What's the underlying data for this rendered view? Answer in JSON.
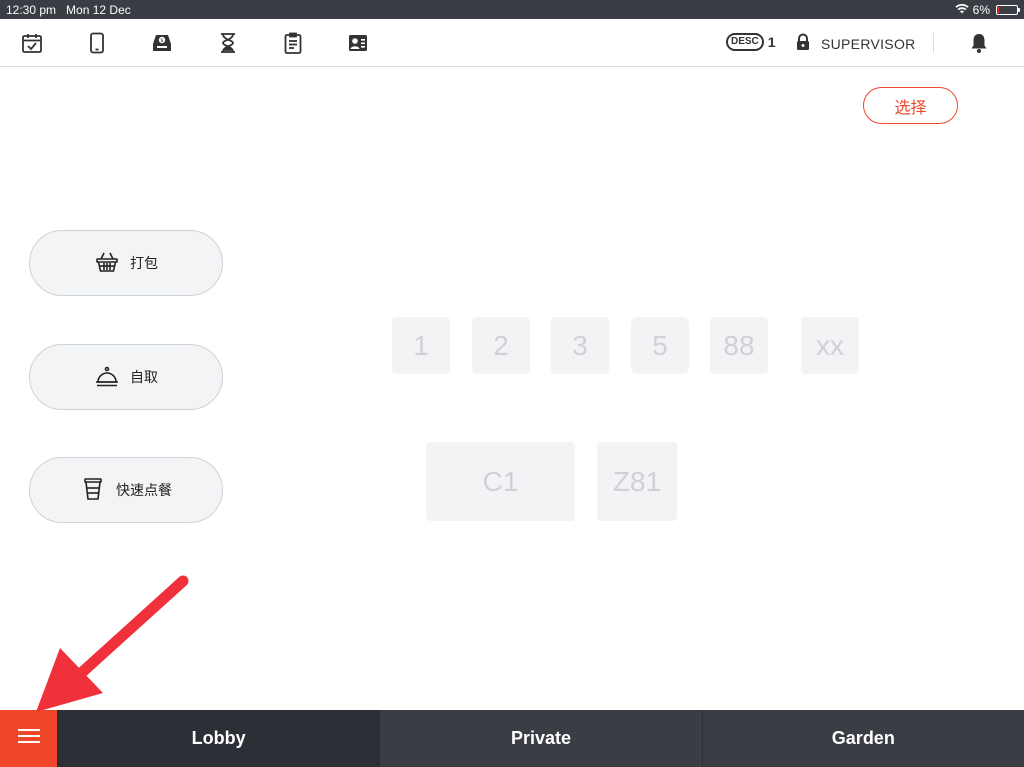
{
  "status_bar": {
    "time": "12:30 pm",
    "date": "Mon 12 Dec",
    "battery": "6%",
    "battery_level": 0.06
  },
  "toolbar": {
    "icons": [
      "calendar-check-icon",
      "tablet-icon",
      "cash-drawer-icon",
      "hourglass-icon",
      "clipboard-icon",
      "staff-card-icon"
    ],
    "desc_label": "DESC",
    "desc_count": "1",
    "role": "SUPERVISOR"
  },
  "select_button": "选择",
  "order_types": [
    {
      "label": "打包",
      "icon": "basket-icon"
    },
    {
      "label": "自取",
      "icon": "cloche-icon"
    },
    {
      "label": "快速点餐",
      "icon": "cup-icon"
    }
  ],
  "tables": [
    "1",
    "2",
    "3",
    "5",
    "88",
    "xx",
    "C1",
    "Z81"
  ],
  "bottom_nav": {
    "tabs": [
      "Lobby",
      "Private",
      "Garden"
    ],
    "active": "Lobby"
  },
  "colors": {
    "accent": "#f0472b",
    "nav_bg": "#3a3d44",
    "tile_bg": "#f2f3f5",
    "arrow": "#f0303a"
  }
}
